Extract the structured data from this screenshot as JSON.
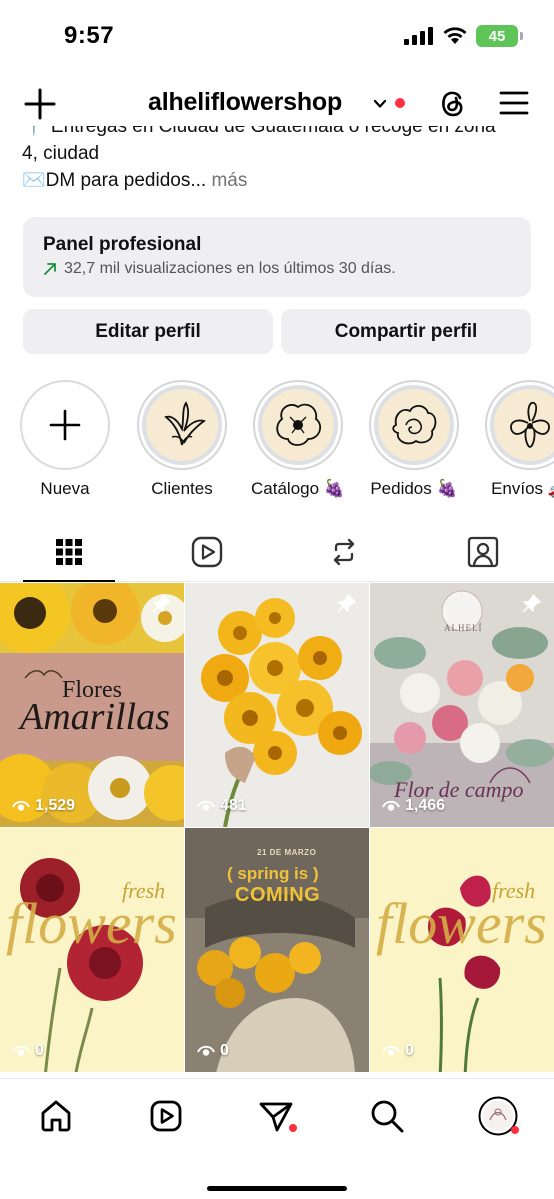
{
  "status_bar": {
    "time": "9:57",
    "battery": "45"
  },
  "header": {
    "username": "alheliflowershop"
  },
  "bio": {
    "cut_line": "📍 Entregas en Ciudad de Guatemala o recoge en zona",
    "line1": "4, ciudad",
    "line2_prefix": "✉️DM para pedidos...",
    "more": " más"
  },
  "panel": {
    "title": "Panel profesional",
    "subtitle": "32,7 mil visualizaciones en los últimos 30 días."
  },
  "buttons": {
    "edit": "Editar perfil",
    "share": "Compartir perfil"
  },
  "highlights": [
    {
      "label": "Nueva"
    },
    {
      "label": "Clientes"
    },
    {
      "label": "Catálogo 🍇"
    },
    {
      "label": "Pedidos 🍇"
    },
    {
      "label": "Envíos 🚚"
    }
  ],
  "tabs": [
    "grid-icon",
    "reels-icon",
    "reposts-icon",
    "tagged-icon"
  ],
  "posts": [
    {
      "views": "1,529",
      "pinned": true,
      "title_small": "Flores",
      "title_big": "Amarillas"
    },
    {
      "views": "481",
      "pinned": true
    },
    {
      "views": "1,466",
      "pinned": true,
      "brand": "ALHELÍ",
      "script": "Flor de campo"
    },
    {
      "views": "0",
      "pinned": false,
      "script_small": "fresh",
      "script_big": "flowers"
    },
    {
      "views": "0",
      "pinned": false,
      "date": "21 DE MARZO",
      "line1": "( spring is )",
      "line2": "COMING"
    },
    {
      "views": "0",
      "pinned": false,
      "script_small": "fresh",
      "script_big": "flowers"
    }
  ],
  "bottom_nav": [
    "home-icon",
    "reels-icon",
    "send-icon",
    "search-icon",
    "profile-avatar"
  ],
  "colors": {
    "notification_dot": "#ff3040",
    "battery_green": "#5fc559",
    "panel_bg": "#efeff1",
    "highlight_bg": "#f6ead3"
  }
}
